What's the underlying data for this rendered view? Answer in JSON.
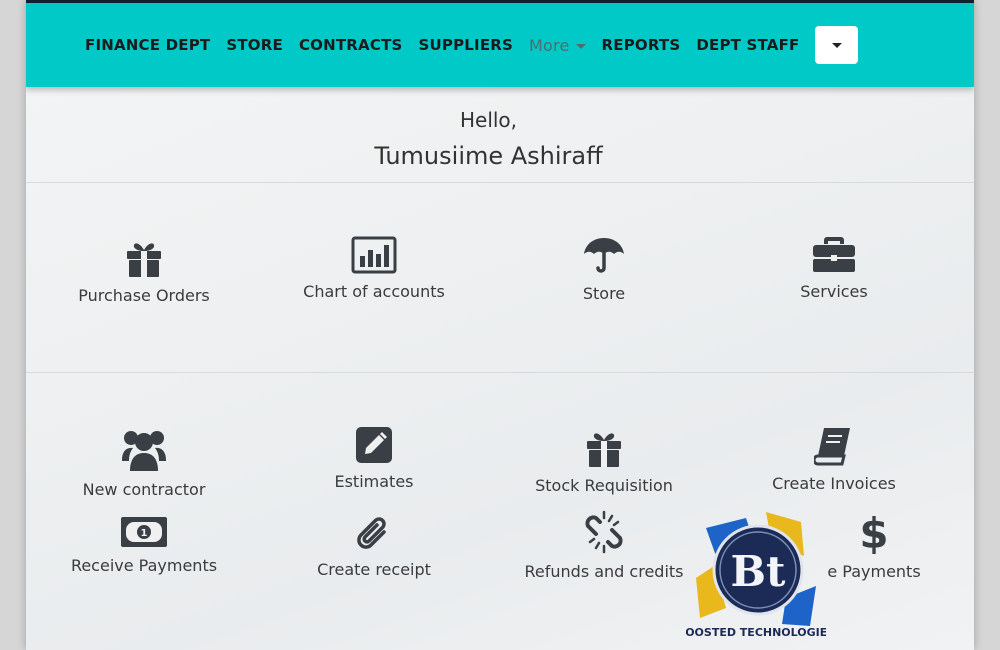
{
  "nav": {
    "items": [
      {
        "label": "FINANCE DEPT",
        "muted": false
      },
      {
        "label": "STORE",
        "muted": false
      },
      {
        "label": "CONTRACTS",
        "muted": false
      },
      {
        "label": "SUPPLIERS",
        "muted": false
      },
      {
        "label": "More",
        "muted": true
      },
      {
        "label": "REPORTS",
        "muted": false
      },
      {
        "label": "DEPT STAFF",
        "muted": false
      }
    ]
  },
  "greeting": {
    "hello": "Hello,",
    "name": "Tumusiime Ashiraff"
  },
  "tiles": [
    {
      "label": "Purchase Orders",
      "icon": "gift-icon"
    },
    {
      "label": "Chart of accounts",
      "icon": "bar-chart-icon"
    },
    {
      "label": "Store",
      "icon": "umbrella-icon"
    },
    {
      "label": "Services",
      "icon": "briefcase-icon"
    },
    {
      "label": "New contractor",
      "icon": "users-icon"
    },
    {
      "label": "Estimates",
      "icon": "pencil-square-icon"
    },
    {
      "label": "Stock Requisition",
      "icon": "gift-icon"
    },
    {
      "label": "Create Invoices",
      "icon": "book-icon"
    },
    {
      "label": "Receive Payments",
      "icon": "money-bill-icon"
    },
    {
      "label": "Create receipt",
      "icon": "paperclip-icon"
    },
    {
      "label": "Refunds and credits",
      "icon": "unlink-icon"
    },
    {
      "label": "e Payments",
      "icon": "dollar-icon"
    }
  ],
  "logo": {
    "text": "BOOSTED TECHNOLOGIES",
    "letters": "Bt"
  },
  "colors": {
    "navbar": "#00c9c8",
    "icon": "#3a3f45"
  }
}
